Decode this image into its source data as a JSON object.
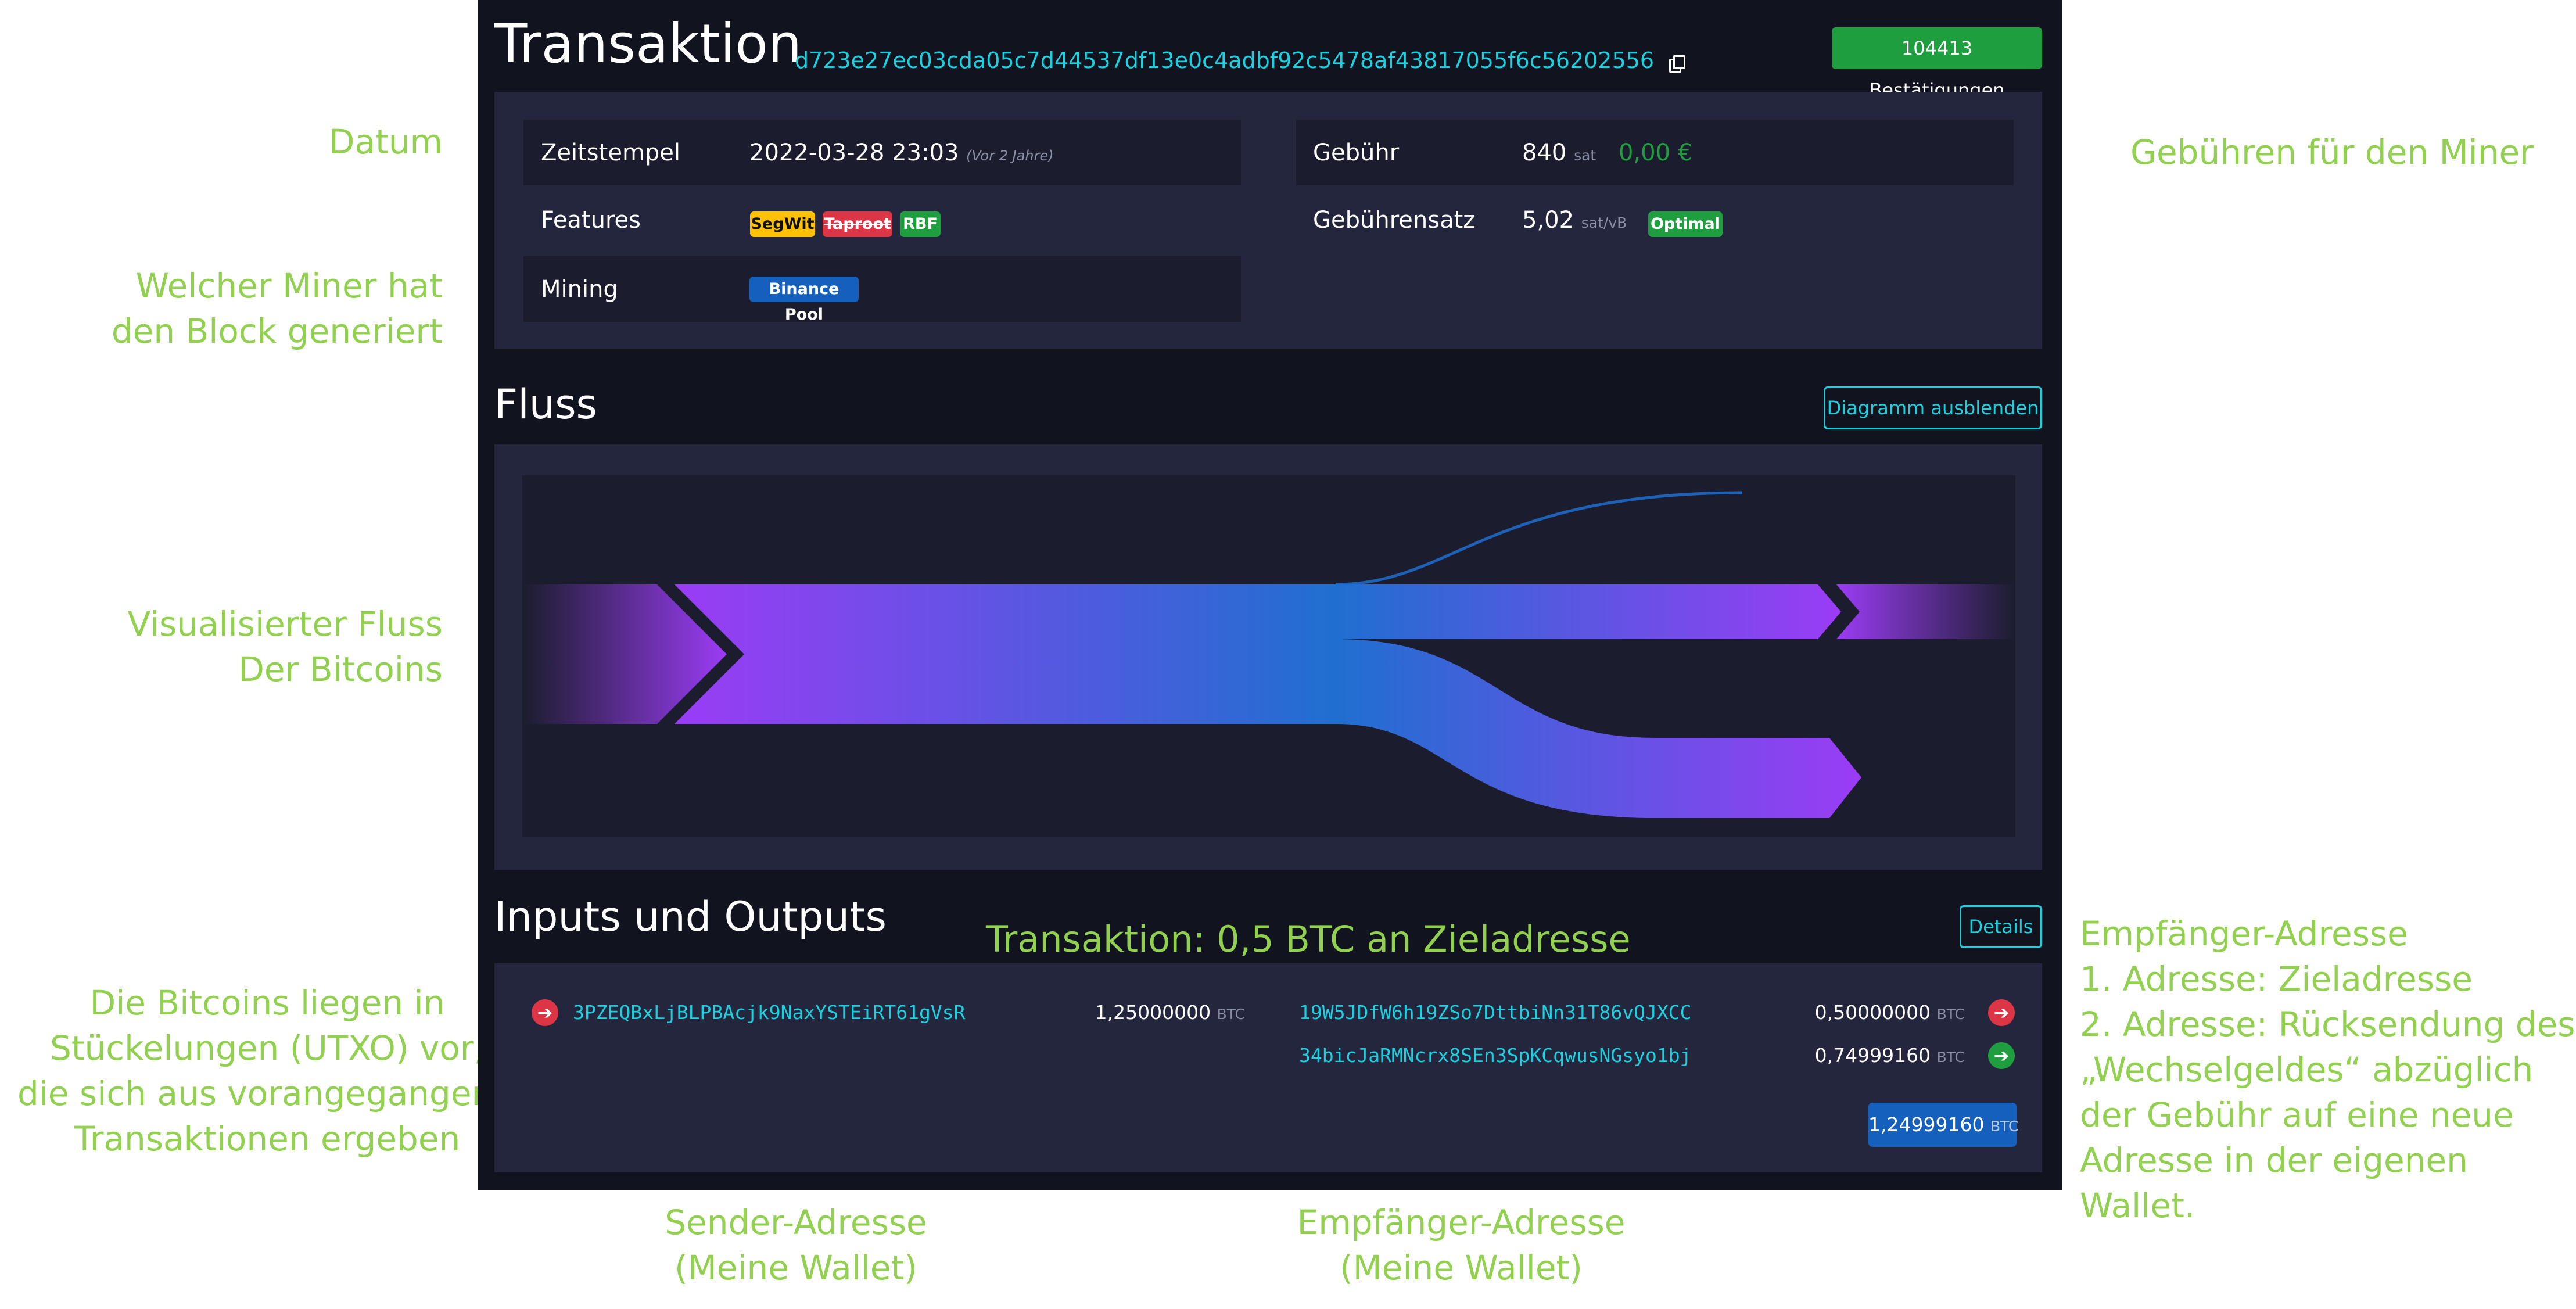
{
  "annotations": {
    "datum": "Datum",
    "miner_line1": "Welcher Miner hat",
    "miner_line2": "den Block generiert",
    "fluss_line1": "Visualisierter Fluss",
    "fluss_line2": "Der Bitcoins",
    "utxo_line1": "Die Bitcoins liegen in",
    "utxo_line2": "Stückelungen (UTXO) vor,",
    "utxo_line3": "die sich aus vorangegangenen",
    "utxo_line4": "Transaktionen ergeben",
    "gebuehren": "Gebühren für den Miner",
    "transaktion": "Transaktion: 0,5 BTC an Zieladresse",
    "empf_right_line1": "Empfänger-Adresse",
    "empf_right_line2": "1. Adresse: Zieladresse",
    "empf_right_line3": "2. Adresse: Rücksendung des",
    "empf_right_line4": "„Wechselgeldes“ abzüglich",
    "empf_right_line5": "der Gebühr auf eine neue",
    "empf_right_line6": "Adresse in der eigenen",
    "empf_right_line7": "Wallet.",
    "sender_line1": "Sender-Adresse",
    "sender_line2": "(Meine Wallet)",
    "empf_bottom_line1": "Empfänger-Adresse",
    "empf_bottom_line2": "(Meine Wallet)"
  },
  "header": {
    "title": "Transaktion",
    "txid": "d723e27ec03cda05c7d44537df13e0c4adbf92c5478af43817055f6c56202556",
    "confirmations": "104413 Bestätigungen"
  },
  "details": {
    "timestamp_label": "Zeitstempel",
    "timestamp_value": "2022-03-28 23:03",
    "timestamp_relative": "(Vor 2 Jahre)",
    "features_label": "Features",
    "features": [
      "SegWit",
      "Taproot",
      "RBF"
    ],
    "mining_label": "Mining",
    "mining_pool": "Binance Pool",
    "fee_label": "Gebühr",
    "fee_value": "840",
    "fee_unit": "sat",
    "fee_eur": "0,00 €",
    "feerate_label": "Gebührensatz",
    "feerate_value": "5,02",
    "feerate_unit": "sat/vB",
    "feerate_badge": "Optimal"
  },
  "flow": {
    "title": "Fluss",
    "toggle_label": "Diagramm ausblenden"
  },
  "io": {
    "title": "Inputs und Outputs",
    "details_label": "Details",
    "inputs": [
      {
        "address": "3PZEQBxLjBLPBAcjk9NaxYSTEiRT61gVsR",
        "amount": "1,25000000",
        "unit": "BTC"
      }
    ],
    "outputs": [
      {
        "address": "19W5JDfW6h19ZSo7DttbiNn31T86vQJXCC",
        "amount": "0,50000000",
        "unit": "BTC"
      },
      {
        "address": "34bicJaRMNcrx8SEn3SpKCqwusNGsyo1bj",
        "amount": "0,74999160",
        "unit": "BTC"
      }
    ],
    "total": "1,24999160",
    "total_unit": "BTC"
  },
  "colors": {
    "panel_bg": "#11131f",
    "box_bg": "#24263d",
    "accent_cyan": "#1bd1e0",
    "green": "#1e9e3e",
    "annotation_green": "#92d050",
    "flow_purple": "#9b3cf5",
    "flow_blue": "#1f6fd0",
    "red": "#dc3545"
  }
}
